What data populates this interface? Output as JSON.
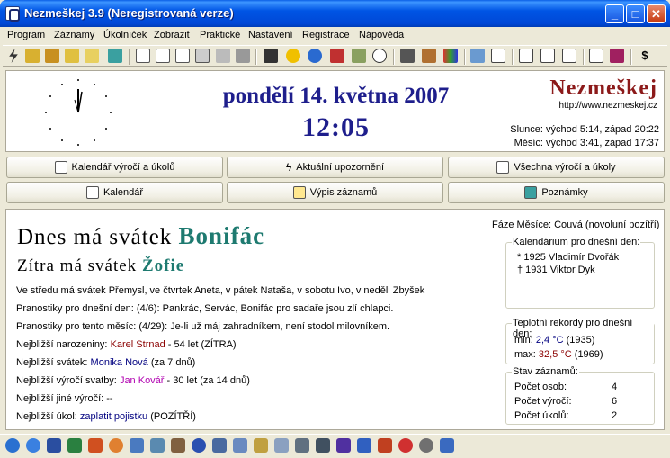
{
  "window": {
    "title": "Nezmeškej 3.9 (Neregistrovaná verze)",
    "minimize": "_",
    "maximize": "□",
    "close": "✕"
  },
  "menu": [
    "Program",
    "Záznamy",
    "Úkolníček",
    "Zobrazit",
    "Praktické",
    "Nastavení",
    "Registrace",
    "Nápověda"
  ],
  "toolbar_icons": [
    "lightning-icon",
    "open-folder-icon",
    "save-icon",
    "new-note-icon",
    "folder-icon",
    "note-icon",
    "calendar21-icon",
    "window-icon",
    "list-icon",
    "grid-icon",
    "book-icon",
    "print-icon",
    "binoculars-icon",
    "sun-icon",
    "globe-icon",
    "heart-icon",
    "image-icon",
    "clock-icon",
    "tools-icon",
    "hourglass-icon",
    "palette-icon",
    "import-icon",
    "home-icon",
    "export-icon",
    "tree-icon",
    "lock-icon",
    "help-icon",
    "info-book-icon",
    "dollar-icon"
  ],
  "header": {
    "date": "pondělí 14. května 2007",
    "time": "12:05",
    "brand": "Nezmeškej",
    "url": "http://www.nezmeskej.cz",
    "sun": "Slunce: východ 5:14, západ 20:22",
    "moon": "Měsíc: východ 3:41, západ 17:37"
  },
  "buttons": {
    "anniversaries_tasks": "Kalendář výročí a úkolů",
    "current_alerts": "Aktuální upozornění",
    "all_anniversaries": "Všechna výročí a úkoly",
    "calendar": "Kalendář",
    "records_list": "Výpis záznamů",
    "notes": "Poznámky"
  },
  "main": {
    "today_prefix": "Dnes má svátek",
    "today_name": "Bonifác",
    "tomorrow_prefix": "Zítra má svátek",
    "tomorrow_name": "Žofie",
    "week_line": "Ve středu má svátek Přemysl, ve čtvrtek Aneta, v pátek Nataša, v sobotu Ivo, v neděli Zbyšek",
    "saying_day": "Pranostiky pro dnešní den: (4/6): Pankrác, Servác, Bonifác pro sadaře jsou zlí chlapci.",
    "saying_month": "Pranostiky pro tento měsíc: (4/29): Je-li už máj zahradníkem, není stodol milovníkem.",
    "birthday_label": "Nejbližší narozeniny:",
    "birthday_name": "Karel Strnad",
    "birthday_info": "- 54 let  (ZÍTRA)",
    "nameday_label": "Nejbližší svátek:",
    "nameday_name": "Monika Nová",
    "nameday_info": "(za 7 dnů)",
    "wedding_label": "Nejbližší výročí svatby:",
    "wedding_name": "Jan Kovář",
    "wedding_info": "- 30 let  (za 14 dnů)",
    "other_label": "Nejbližší jiné výročí:",
    "other_value": "--",
    "task_label": "Nejbližší úkol:",
    "task_name": "zaplatit pojistku",
    "task_info": "(POZÍTŘÍ)",
    "moon_phase": "Fáze Měsíce: Couvá (novoluní pozítří)"
  },
  "calendarium": {
    "title": "Kalendárium pro dnešní den:",
    "born": "* 1925 Vladimír Dvořák",
    "died": "† 1931 Viktor Dyk"
  },
  "temps": {
    "title": "Teplotní rekordy pro dnešní den:",
    "min_label": "min:",
    "min_value": "2,4 °C",
    "min_year": "(1935)",
    "max_label": "max:",
    "max_value": "32,5 °C",
    "max_year": "(1969)"
  },
  "stats": {
    "title": "Stav záznamů:",
    "persons_label": "Počet osob:",
    "persons": "4",
    "anniv_label": "Počet výročí:",
    "anniv": "6",
    "tasks_label": "Počet úkolů:",
    "tasks": "2"
  },
  "taskbar_icons": [
    "xp-start-icon",
    "ie-icon",
    "word-icon",
    "excel-icon",
    "powerpoint-icon",
    "clock-app-icon",
    "network-icon",
    "wizard-icon",
    "video-icon",
    "media-player-icon",
    "window-app-icon",
    "document-icon",
    "archive-icon",
    "shield-icon",
    "chat-icon",
    "camera-icon",
    "scanner-icon",
    "game-icon",
    "puzzle-icon",
    "battery-icon",
    "toolbox-icon",
    "heart-app-icon",
    "disc-icon",
    "settings-app-icon"
  ]
}
